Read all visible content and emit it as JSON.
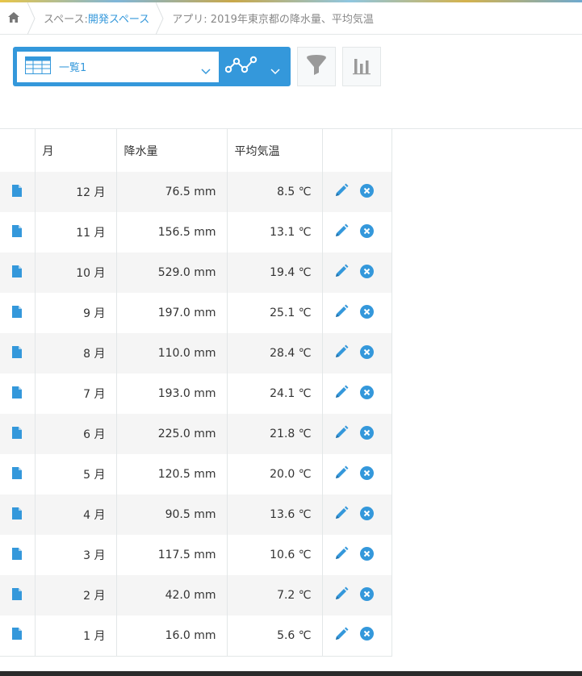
{
  "breadcrumb": {
    "space_prefix": "スペース: ",
    "space_link": "開発スペース",
    "app_label": "アプリ: 2019年東京都の降水量、平均気温"
  },
  "toolbar": {
    "view_name": "一覧1"
  },
  "table": {
    "headers": {
      "month": "月",
      "rain": "降水量",
      "temp": "平均気温"
    },
    "rows": [
      {
        "month": "12 月",
        "rain": "76.5 mm",
        "temp": "8.5 ℃"
      },
      {
        "month": "11 月",
        "rain": "156.5 mm",
        "temp": "13.1 ℃"
      },
      {
        "month": "10 月",
        "rain": "529.0 mm",
        "temp": "19.4 ℃"
      },
      {
        "month": "9 月",
        "rain": "197.0 mm",
        "temp": "25.1 ℃"
      },
      {
        "month": "8 月",
        "rain": "110.0 mm",
        "temp": "28.4 ℃"
      },
      {
        "month": "7 月",
        "rain": "193.0 mm",
        "temp": "24.1 ℃"
      },
      {
        "month": "6 月",
        "rain": "225.0 mm",
        "temp": "21.8 ℃"
      },
      {
        "month": "5 月",
        "rain": "120.5 mm",
        "temp": "20.0 ℃"
      },
      {
        "month": "4 月",
        "rain": "90.5 mm",
        "temp": "13.6 ℃"
      },
      {
        "month": "3 月",
        "rain": "117.5 mm",
        "temp": "10.6 ℃"
      },
      {
        "month": "2 月",
        "rain": "42.0 mm",
        "temp": "7.2 ℃"
      },
      {
        "month": "1 月",
        "rain": "16.0 mm",
        "temp": "5.6 ℃"
      }
    ]
  },
  "icons": {
    "home": "home-icon",
    "view": "table-view-icon",
    "graph": "line-graph-icon",
    "filter": "filter-funnel-icon",
    "chart": "bar-chart-icon",
    "record": "document-icon",
    "edit": "pencil-icon",
    "delete": "close-circle-icon"
  },
  "colors": {
    "accent": "#3498db",
    "gray_icon": "#9a9a9a"
  }
}
